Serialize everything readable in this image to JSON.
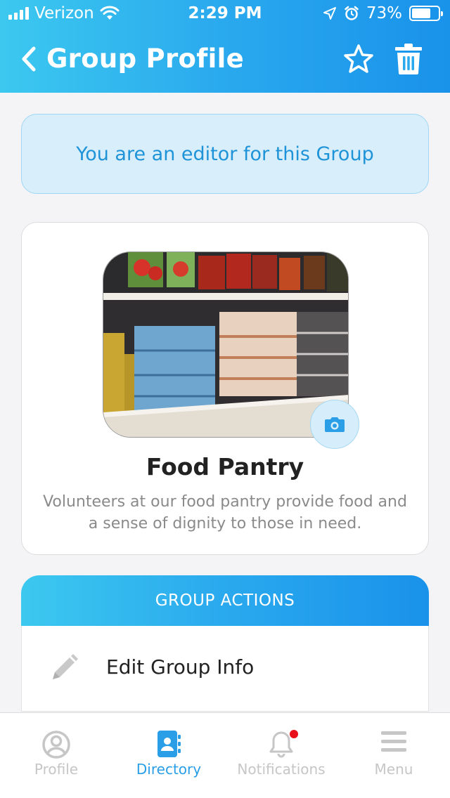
{
  "status_bar": {
    "carrier": "Verizon",
    "time": "2:29 PM",
    "battery_percent": "73%",
    "battery_level": 0.73,
    "signal_bars": 4
  },
  "header": {
    "title": "Group Profile",
    "back_icon": "chevron-left-icon",
    "favorite_icon": "star-icon",
    "delete_icon": "trash-icon"
  },
  "editor_banner": {
    "text": "You are an editor for this Group"
  },
  "group": {
    "name": "Food Pantry",
    "description": "Volunteers at our food pantry provide food and a sense of dignity to those in need.",
    "photo_alt": "Food pantry shelves",
    "camera_icon": "camera-icon"
  },
  "group_actions": {
    "header": "GROUP ACTIONS",
    "items": [
      {
        "label": "Edit Group Info",
        "icon": "pencil-icon"
      }
    ]
  },
  "tab_bar": {
    "tabs": [
      {
        "label": "Profile",
        "icon": "user-circle-icon",
        "active": false
      },
      {
        "label": "Directory",
        "icon": "address-book-icon",
        "active": true
      },
      {
        "label": "Notifications",
        "icon": "bell-icon",
        "active": false,
        "has_badge": true
      },
      {
        "label": "Menu",
        "icon": "hamburger-menu-icon",
        "active": false
      }
    ]
  },
  "colors": {
    "brand_gradient_start": "#3cc8ef",
    "brand_gradient_end": "#1992ea",
    "active_tab": "#2a9ee6",
    "inactive_tab": "#c6c6c6",
    "notification_badge": "#e8101b"
  }
}
